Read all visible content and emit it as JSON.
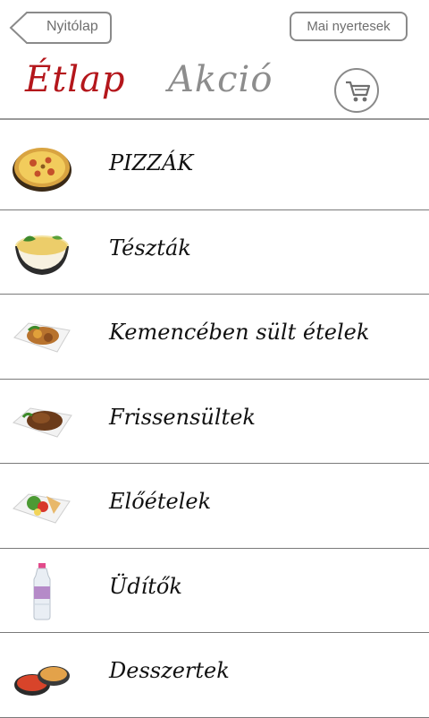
{
  "header": {
    "back_label": "Nyitólap",
    "winners_label": "Mai nyertesek",
    "tab_menu": "Étlap",
    "tab_promo": "Akció",
    "cart_icon": "shopping-cart-icon"
  },
  "colors": {
    "active_tab": "#b4161b",
    "inactive_tab": "#8d8d8d",
    "button_border": "#8a8a8a"
  },
  "categories": [
    {
      "label": "PIZZÁK",
      "icon": "pizza-icon"
    },
    {
      "label": "Tészták",
      "icon": "pasta-bowl-icon"
    },
    {
      "label": "Kemencében sült ételek",
      "icon": "oven-dish-icon"
    },
    {
      "label": "Frissensültek",
      "icon": "roast-meat-icon"
    },
    {
      "label": "Előételek",
      "icon": "appetizer-plate-icon"
    },
    {
      "label": "Üdítők",
      "icon": "water-bottle-icon"
    },
    {
      "label": "Desszertek",
      "icon": "dessert-icon"
    }
  ]
}
